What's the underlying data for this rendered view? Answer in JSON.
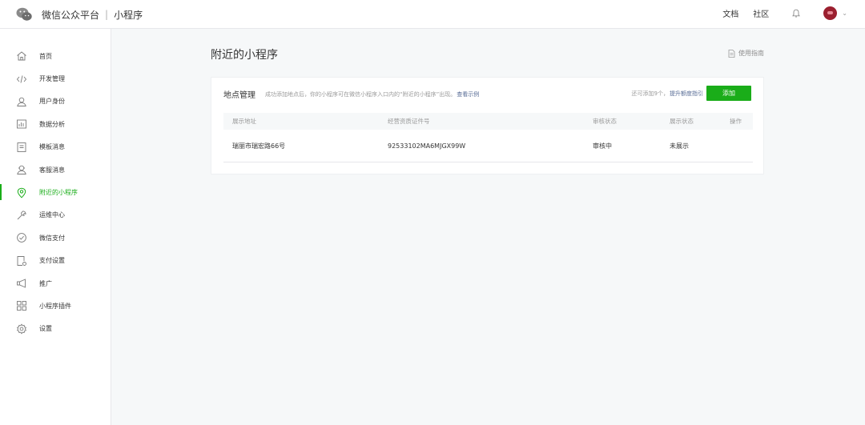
{
  "header": {
    "brand_title": "微信公众平台",
    "separator": "|",
    "brand_sub": "小程序",
    "links": [
      "文档",
      "社区"
    ],
    "bell_icon": "bell-icon",
    "avatar_color": "#9b1f2f"
  },
  "sidebar": {
    "active_color": "#1aad19",
    "items": [
      {
        "label": "首页",
        "icon": "home-icon"
      },
      {
        "label": "开发管理",
        "icon": "code-icon"
      },
      {
        "label": "用户身份",
        "icon": "user-icon"
      },
      {
        "label": "数据分析",
        "icon": "chart-icon"
      },
      {
        "label": "模板消息",
        "icon": "template-icon"
      },
      {
        "label": "客服消息",
        "icon": "service-icon"
      },
      {
        "label": "附近的小程序",
        "icon": "location-icon",
        "active": true
      },
      {
        "label": "运维中心",
        "icon": "wrench-icon"
      },
      {
        "label": "微信支付",
        "icon": "payment-icon"
      },
      {
        "label": "支付设置",
        "icon": "pay-settings-icon"
      },
      {
        "label": "推广",
        "icon": "megaphone-icon"
      },
      {
        "label": "小程序插件",
        "icon": "plugin-icon"
      },
      {
        "label": "设置",
        "icon": "gear-icon"
      }
    ]
  },
  "main": {
    "page_title": "附近的小程序",
    "guide_link": "使用指南",
    "card": {
      "title": "地点管理",
      "desc": "成功添加地点后，你的小程序可在微信小程序入口内的“附近的小程序”出现。",
      "example_link": "查看示例",
      "quota_text": "还可添加9个，",
      "quota_link": "提升额度指引",
      "add_button": "添加",
      "table": {
        "columns": [
          "展示地址",
          "经营资质证件号",
          "审核状态",
          "展示状态",
          "操作"
        ],
        "rows": [
          [
            "瑞丽市瑞宏路66号",
            "92533102MA6MJGX99W",
            "审核中",
            "未展示",
            ""
          ]
        ]
      }
    }
  }
}
